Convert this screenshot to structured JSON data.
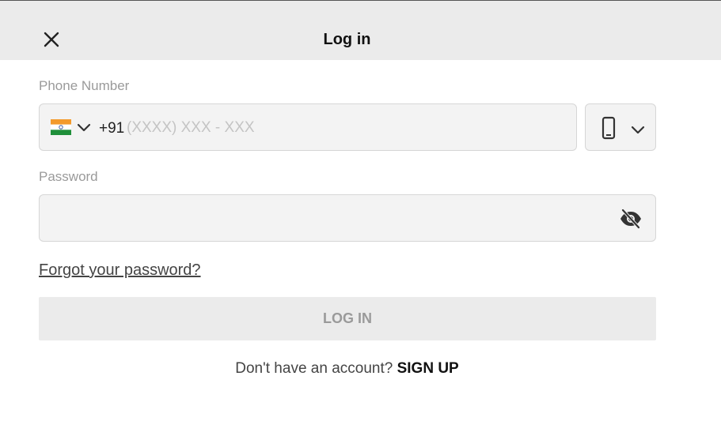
{
  "header": {
    "title": "Log in",
    "close_icon": "close-icon"
  },
  "phone": {
    "label": "Phone Number",
    "country_flag": "india-flag-icon",
    "dial_code": "+91",
    "value": "",
    "placeholder": "(XXXX) XXX - XXX",
    "method_icon": "mobile-phone-icon"
  },
  "password": {
    "label": "Password",
    "value": "",
    "visibility_icon": "eye-slash-icon"
  },
  "links": {
    "forgot_password": "Forgot your password?"
  },
  "actions": {
    "login_label": "LOG IN"
  },
  "signup": {
    "prompt": "Don't have an account?",
    "link_label": "SIGN UP"
  },
  "colors": {
    "header_bg": "#ebebeb",
    "field_bg": "#f3f3f3",
    "button_disabled_bg": "#ebebeb",
    "button_disabled_text": "#9a9a9a"
  }
}
